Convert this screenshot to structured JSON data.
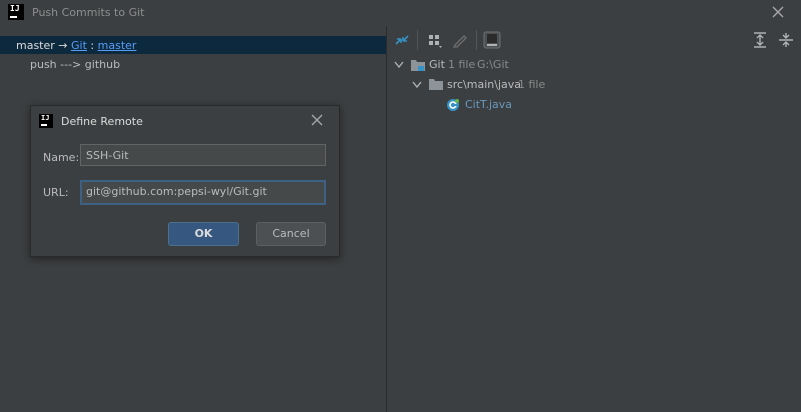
{
  "window": {
    "title": "Push Commits to Git"
  },
  "left": {
    "selected_row": {
      "branch": "master",
      "arrow": "→",
      "remote": "Git",
      "sep": ":",
      "target_branch": "master"
    },
    "sub_row": "push ---> github"
  },
  "toolbar": {
    "icons": [
      "collapse-arrows-icon",
      "group-by-icon",
      "edit-icon",
      "show-diff-icon",
      "expand-all-icon",
      "collapse-all-icon"
    ]
  },
  "tree": {
    "root": {
      "name": "Git",
      "count": "1 file",
      "path": "G:\\Git"
    },
    "folder": {
      "name": "src\\main\\java",
      "count": "1 file"
    },
    "file": {
      "name": "CitT.java"
    }
  },
  "dialog": {
    "title": "Define Remote",
    "name_label": "Name:",
    "name_value": "SSH-Git",
    "url_label": "URL:",
    "url_value": "git@github.com:pepsi-wyl/Git.git",
    "ok_label": "OK",
    "cancel_label": "Cancel"
  },
  "colors": {
    "accent": "#365880",
    "link": "#589df6",
    "selection": "#0d293e",
    "background": "#3c3f41"
  }
}
